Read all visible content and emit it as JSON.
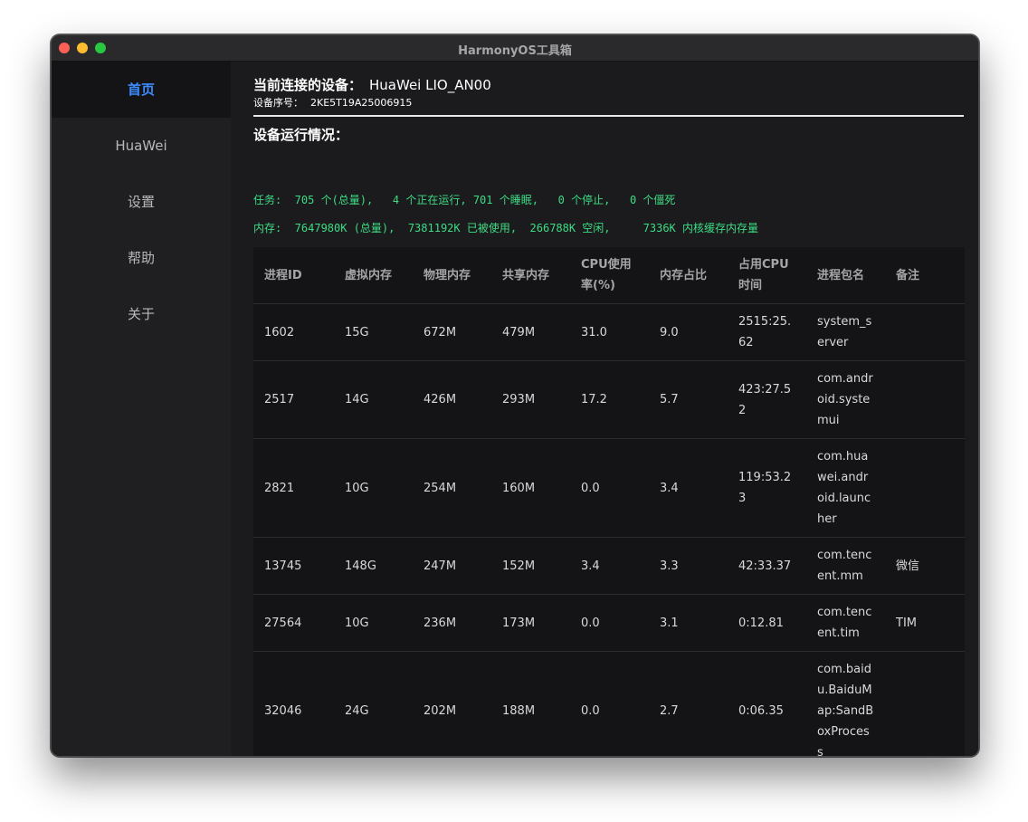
{
  "window": {
    "title": "HarmonyOS工具箱"
  },
  "sidebar": {
    "items": [
      {
        "label": "首页",
        "active": true
      },
      {
        "label": "HuaWei",
        "active": false
      },
      {
        "label": "设置",
        "active": false
      },
      {
        "label": "帮助",
        "active": false
      },
      {
        "label": "关于",
        "active": false
      }
    ]
  },
  "device": {
    "connected_label": "当前连接的设备：",
    "name": "HuaWei LIO_AN00",
    "serial_label": "设备序号：",
    "serial": "2KE5T19A25006915"
  },
  "status": {
    "title": "设备运行情况：",
    "tasks_line": "任务:  705 个(总量),   4 个正在运行, 701 个睡眠,   0 个停止,   0 个僵死",
    "memory_line": "内存:  7647980K (总量),  7381192K 已被使用,  266788K 空闲,     7336K 内核缓存内存量"
  },
  "table": {
    "columns": [
      "进程ID",
      "虚拟内存",
      "物理内存",
      "共享内存",
      "CPU使用率(%)",
      "内存占比",
      "占用CPU时间",
      "进程包名",
      "备注"
    ],
    "rows": [
      [
        "1602",
        "15G",
        "672M",
        "479M",
        "31.0",
        "9.0",
        "2515:25.62",
        "system_server",
        ""
      ],
      [
        "2517",
        "14G",
        "426M",
        "293M",
        "17.2",
        "5.7",
        "423:27.52",
        "com.android.systemui",
        ""
      ],
      [
        "2821",
        "10G",
        "254M",
        "160M",
        "0.0",
        "3.4",
        "119:53.23",
        "com.huawei.android.launcher",
        ""
      ],
      [
        "13745",
        "148G",
        "247M",
        "152M",
        "3.4",
        "3.3",
        "42:33.37",
        "com.tencent.mm",
        "微信"
      ],
      [
        "27564",
        "10G",
        "236M",
        "173M",
        "0.0",
        "3.1",
        "0:12.81",
        "com.tencent.tim",
        "TIM"
      ],
      [
        "32046",
        "24G",
        "202M",
        "188M",
        "0.0",
        "2.7",
        "0:06.35",
        "com.baidu.BaiduMap:SandBoxProcess",
        ""
      ]
    ]
  },
  "colors": {
    "accent": "#3d8bfd",
    "status_text": "#3ddc84",
    "window_bg": "#1b1b1d",
    "sidebar_bg": "#1f1f21",
    "table_bg": "#141416"
  }
}
